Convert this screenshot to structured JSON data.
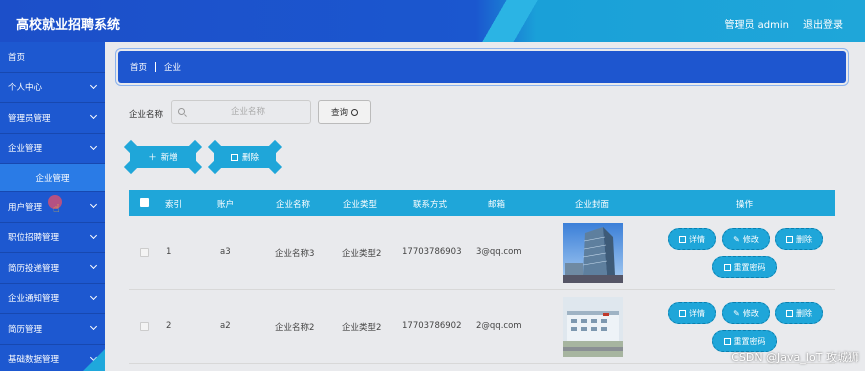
{
  "header": {
    "app_title": "高校就业招聘系统",
    "admin_label": "管理员 admin",
    "logout_label": "退出登录"
  },
  "sidebar": {
    "items": [
      {
        "label": "首页",
        "has_chevron": false
      },
      {
        "label": "个人中心",
        "has_chevron": true
      },
      {
        "label": "管理员管理",
        "has_chevron": true
      },
      {
        "label": "企业管理",
        "has_chevron": true
      },
      {
        "label": "用户管理",
        "has_chevron": true
      },
      {
        "label": "职位招聘管理",
        "has_chevron": true
      },
      {
        "label": "简历投递管理",
        "has_chevron": true
      },
      {
        "label": "企业通知管理",
        "has_chevron": true
      },
      {
        "label": "简历管理",
        "has_chevron": true
      },
      {
        "label": "基础数据管理",
        "has_chevron": true
      }
    ],
    "active_sub_item": "企业管理"
  },
  "breadcrumb": {
    "home": "首页",
    "current": "企业"
  },
  "search": {
    "label": "企业名称",
    "placeholder": "企业名称",
    "query_button": "查询"
  },
  "actions": {
    "add_label": "新增",
    "delete_label": "删除"
  },
  "table": {
    "columns": [
      "索引",
      "账户",
      "企业名称",
      "企业类型",
      "联系方式",
      "邮箱",
      "企业封面",
      "操作"
    ],
    "rows": [
      {
        "index": "1",
        "account": "a3",
        "name": "企业名称3",
        "type": "企业类型2",
        "phone": "17703786903",
        "email": "3@qq.com"
      },
      {
        "index": "2",
        "account": "a2",
        "name": "企业名称2",
        "type": "企业类型2",
        "phone": "17703786902",
        "email": "2@qq.com"
      }
    ],
    "op_labels": {
      "detail": "详情",
      "edit": "修改",
      "delete": "删除",
      "reset_password": "重置密码"
    }
  },
  "watermark": "CSDN @Java_IoT 攻城狮",
  "colors": {
    "primary_blue": "#1d58d0",
    "accent_cyan": "#1fa6d9",
    "background": "#e9eaed"
  }
}
